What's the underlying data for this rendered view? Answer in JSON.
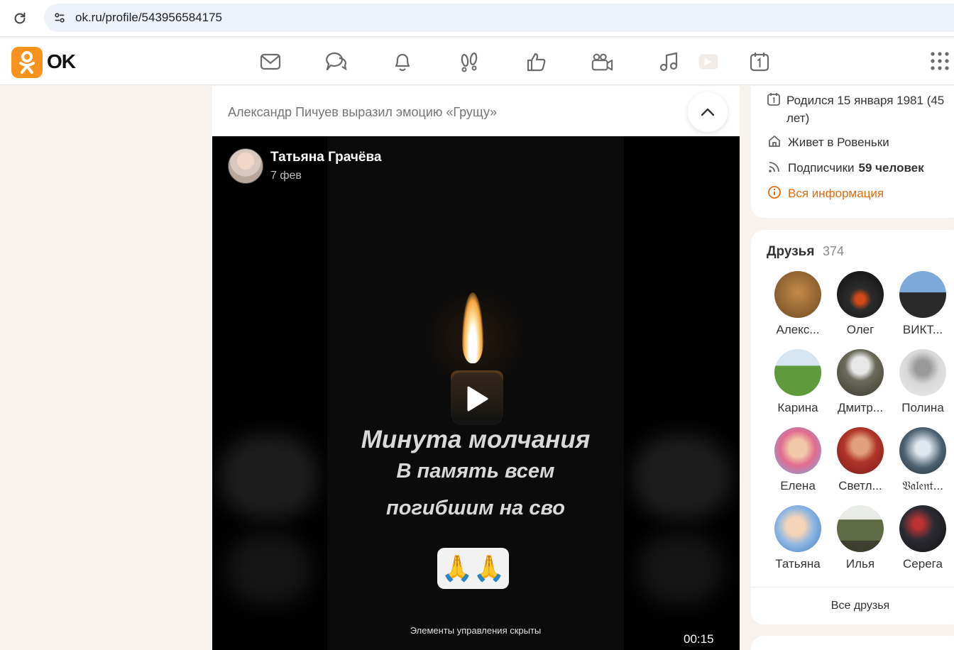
{
  "browser": {
    "url": "ok.ru/profile/543956584175"
  },
  "header": {
    "logo_text": "OK",
    "nav_icons": [
      "messages-icon",
      "discussions-icon",
      "notifications-icon",
      "guests-icon",
      "reactions-icon",
      "videocall-icon",
      "music-icon",
      "video-icon",
      "calendar-icon"
    ]
  },
  "feed": {
    "event_text": "Александр Пичуев выразил эмоцию «Грущу»",
    "post": {
      "author": "Татьяна Грачёва",
      "date": "7 фев",
      "video_text": [
        "Минута молчания",
        "В память всем",
        "погибшим на сво"
      ],
      "emoji": "🙏🙏",
      "controls_note": "Элементы управления скрыты",
      "duration": "00:15"
    }
  },
  "profile_info": {
    "birth": "Родился 15 января 1981 (45 лет)",
    "lives": "Живет в Ровеньки",
    "subscribers_label": "Подписчики",
    "subscribers_count": "59 человек",
    "all_info": "Вся информация"
  },
  "friends": {
    "title": "Друзья",
    "count": "374",
    "list": [
      {
        "name": "Алекс..."
      },
      {
        "name": "Олег"
      },
      {
        "name": "ВИКТ..."
      },
      {
        "name": "Карина"
      },
      {
        "name": "Дмитр..."
      },
      {
        "name": "Полина"
      },
      {
        "name": "Елена"
      },
      {
        "name": "Светл..."
      },
      {
        "name": "𝔙𝔞𝔩𝔢𝔫𝔱..."
      },
      {
        "name": "Татьяна"
      },
      {
        "name": "Илья"
      },
      {
        "name": "Серега"
      }
    ],
    "all_link": "Все друзья"
  },
  "colors": {
    "brand": "#f7931e",
    "link": "#e56b0b",
    "page_bg": "#f7f2ee"
  }
}
